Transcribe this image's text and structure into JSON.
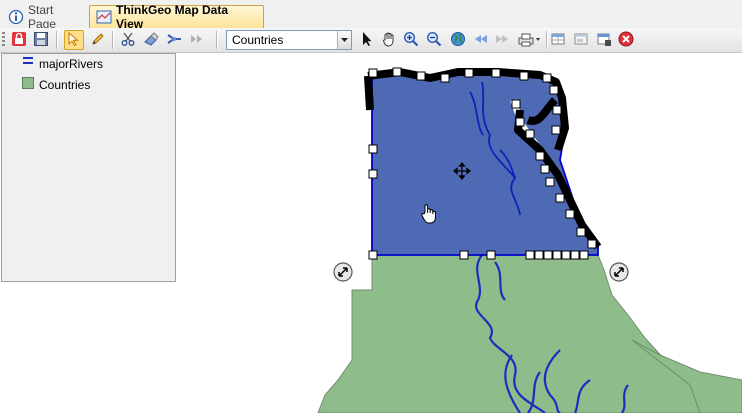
{
  "tabs": [
    {
      "label": "Start Page",
      "icon": "info-icon"
    },
    {
      "label": "ThinkGeo Map Data View",
      "icon": "map-data-icon"
    }
  ],
  "toolbar": {
    "layer_select": {
      "value": "Countries"
    },
    "tools": [
      "lock-icon",
      "save-icon",
      "select-arrow-icon",
      "edit-pencil-icon",
      "cut-icon",
      "eraser-icon",
      "merge-icon",
      "forward-icon",
      "pointer-icon",
      "pan-hand-icon",
      "zoom-in-icon",
      "zoom-out-icon",
      "globe-icon",
      "back-icon",
      "next-icon",
      "print-icon",
      "table-icon",
      "window-icon",
      "layer-export-icon",
      "close-icon"
    ]
  },
  "legend": {
    "items": [
      {
        "label": "majorRivers",
        "icon": "river-line-icon"
      },
      {
        "label": "Countries",
        "icon": "country-fill-icon"
      }
    ]
  },
  "map": {
    "selected_feature_fill": "#4f6ab5",
    "selected_feature_stroke": "#0000cc",
    "country_fill": "#8fbc8b",
    "river_color": "#1a2fc0"
  }
}
